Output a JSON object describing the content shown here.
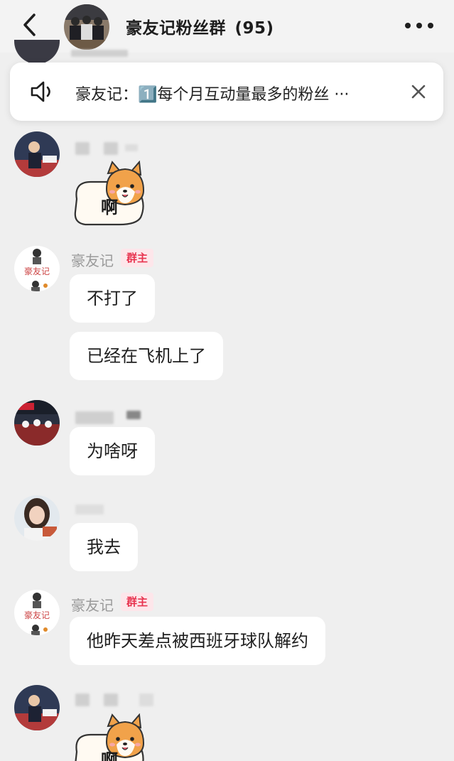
{
  "header": {
    "group_name": "豪友记粉丝群",
    "member_count": "(95)"
  },
  "notice": {
    "text": "豪友记：1️⃣每个月互动量最多的粉丝 ···"
  },
  "messages": [
    {
      "sender": "",
      "sticker_text": "啊"
    },
    {
      "sender": "豪友记",
      "badge": "群主",
      "texts": [
        "不打了",
        "已经在飞机上了"
      ]
    },
    {
      "sender": "",
      "texts": [
        "为啥呀"
      ]
    },
    {
      "sender": "",
      "texts": [
        "我去"
      ]
    },
    {
      "sender": "豪友记",
      "badge": "群主",
      "texts": [
        "他昨天差点被西班牙球队解约"
      ]
    },
    {
      "sender": "",
      "sticker_text": "啊"
    }
  ],
  "colors": {
    "background": "#efefef",
    "bubble": "#ffffff",
    "owner_badge_text": "#e8334f",
    "owner_badge_bg": "#fde6ea"
  }
}
